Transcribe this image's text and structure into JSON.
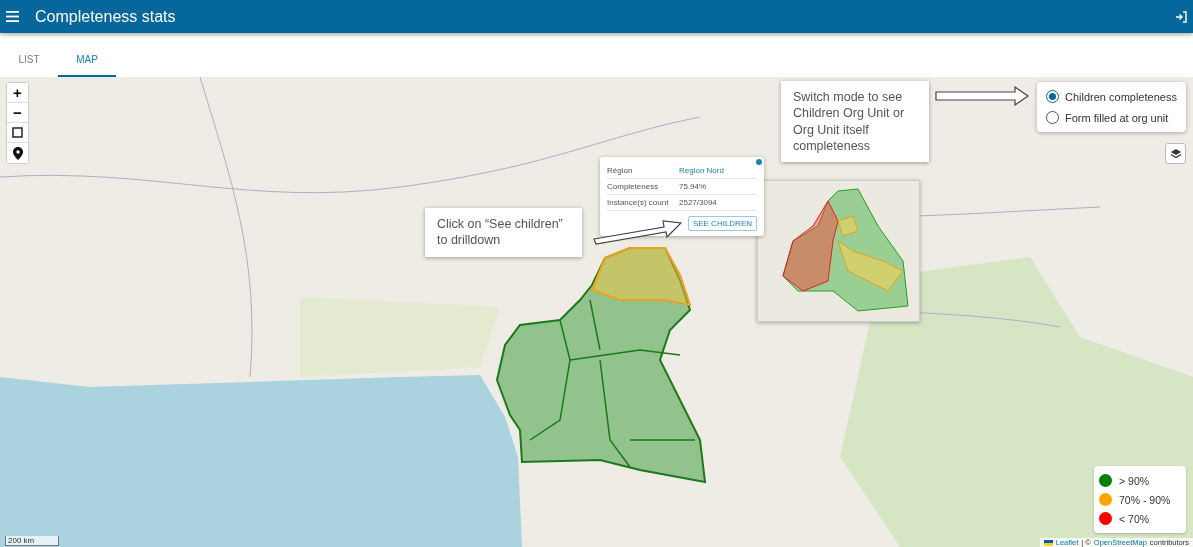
{
  "header": {
    "title": "Completeness stats"
  },
  "tabs": [
    {
      "label": "LIST",
      "selected": false
    },
    {
      "label": "MAP",
      "selected": true
    }
  ],
  "map": {
    "zoom_controls": [
      "+",
      "−"
    ],
    "mode_options": [
      {
        "label": "Children completeness",
        "selected": true
      },
      {
        "label": "Form filled at org unit",
        "selected": false
      }
    ],
    "popup": {
      "rows": [
        {
          "label": "Région",
          "value": "Region Nord",
          "kind": "link"
        },
        {
          "label": "Completeness",
          "value": "75.94%",
          "kind": "text"
        },
        {
          "label": "Instance(s) count",
          "value": "2527/3094",
          "kind": "text"
        }
      ],
      "button": "SEE CHILDREN"
    },
    "annotations": [
      {
        "text": "Switch mode to see Children Org Unit or Org Unit itself completeness"
      },
      {
        "text": "Click on “See children” to drilldown"
      }
    ],
    "legend": [
      {
        "label": "> 90%",
        "color": "#008000"
      },
      {
        "label": "70% - 90%",
        "color": "#ffa500"
      },
      {
        "label": "< 70%",
        "color": "#ff0000"
      }
    ],
    "scale": "200 km",
    "attribution": {
      "library": "Leaflet",
      "separator": "| ©",
      "source": "OpenStreetMap",
      "suffix": "contributors"
    }
  }
}
